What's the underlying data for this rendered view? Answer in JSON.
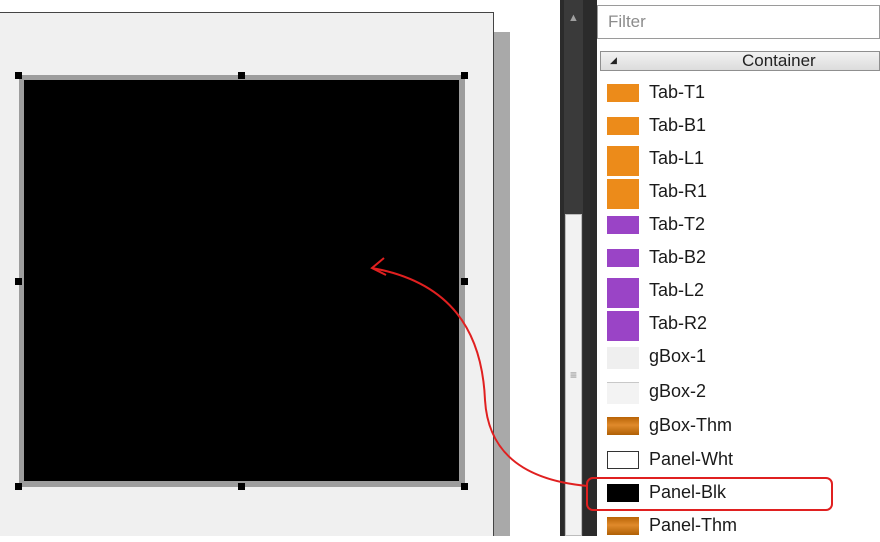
{
  "library": {
    "filter": {
      "placeholder": "Filter",
      "value": ""
    },
    "category": {
      "label": "Container",
      "expanded": true
    },
    "items": [
      {
        "label": "Tab-T1",
        "thumb": "tab-top-orange"
      },
      {
        "label": "Tab-B1",
        "thumb": "tab-bottom-orange"
      },
      {
        "label": "Tab-L1",
        "thumb": "tab-left-orange"
      },
      {
        "label": "Tab-R1",
        "thumb": "tab-right-orange"
      },
      {
        "label": "Tab-T2",
        "thumb": "tab-top-purple"
      },
      {
        "label": "Tab-B2",
        "thumb": "tab-bottom-purple"
      },
      {
        "label": "Tab-L2",
        "thumb": "tab-left-purple"
      },
      {
        "label": "Tab-R2",
        "thumb": "tab-right-purple"
      },
      {
        "label": "gBox-1",
        "thumb": "group-box-light"
      },
      {
        "label": "gBox-2",
        "thumb": "group-box-light"
      },
      {
        "label": "gBox-Thm",
        "thumb": "group-box-theme"
      },
      {
        "label": "Panel-Wht",
        "thumb": "panel-white"
      },
      {
        "label": "Panel-Blk",
        "thumb": "panel-black",
        "highlighted": true
      },
      {
        "label": "Panel-Thm",
        "thumb": "panel-theme"
      }
    ]
  },
  "canvas": {
    "widget": "panel-black",
    "selected": true
  },
  "annotation": {
    "type": "arrow",
    "from": "Panel-Blk",
    "to": "canvas",
    "color": "#e02020"
  },
  "colors": {
    "orange": "#ec8b1a",
    "purple": "#9a44c6",
    "highlight": "#e02020",
    "scrollbar": "#2b2b2b"
  }
}
